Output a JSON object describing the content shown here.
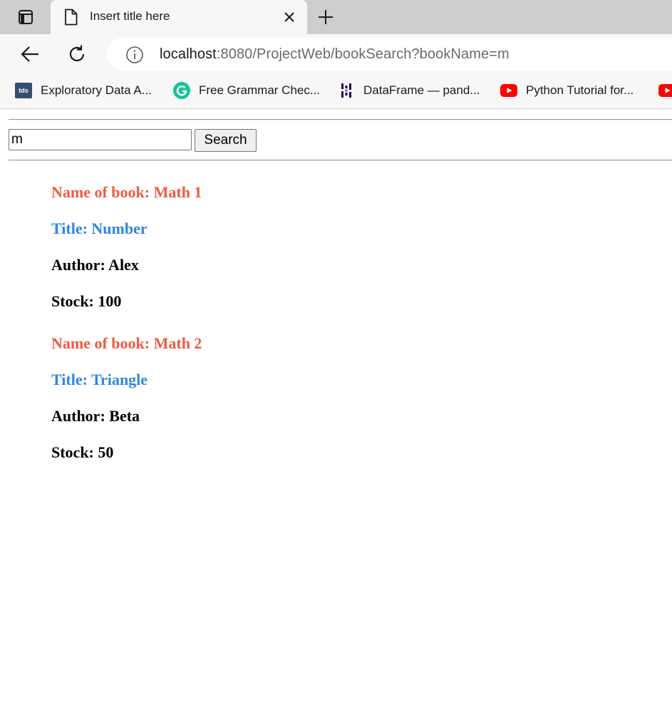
{
  "browser": {
    "tab": {
      "title": "Insert title here"
    },
    "address_bar": {
      "host": "localhost",
      "path": ":8080/ProjectWeb/bookSearch?bookName=m"
    },
    "bookmarks": [
      {
        "label": "Exploratory Data A...",
        "icon": "tds-icon",
        "icon_text": "tds"
      },
      {
        "label": "Free Grammar Chec...",
        "icon": "grammarly-icon"
      },
      {
        "label": "DataFrame — pand...",
        "icon": "pandas-icon"
      },
      {
        "label": "Python Tutorial for...",
        "icon": "youtube-icon"
      },
      {
        "label": "",
        "icon": "youtube-icon"
      }
    ]
  },
  "page": {
    "search": {
      "value": "m",
      "button_label": "Search"
    },
    "books": [
      {
        "name": "Name of book: Math 1",
        "title": "Title: Number",
        "author": "Author: Alex",
        "stock": "Stock: 100"
      },
      {
        "name": "Name of book: Math 2",
        "title": "Title: Triangle",
        "author": "Author: Beta",
        "stock": "Stock: 50"
      }
    ]
  },
  "colors": {
    "book_name": "#ee5a43",
    "book_title": "#2f86e3",
    "body_text": "#000000",
    "youtube_red": "#ff0000",
    "grammarly_green": "#15c39a",
    "tds_blue": "#34506e"
  }
}
